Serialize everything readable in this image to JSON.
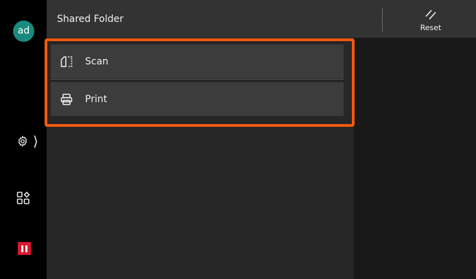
{
  "rail": {
    "avatar_text": "ad",
    "settings_icon": "gear-icon",
    "apps_icon": "apps-icon",
    "stop_icon": "pause-icon",
    "stop_color": "#d8182f"
  },
  "header": {
    "title": "Shared Folder",
    "reset_label": "Reset",
    "reset_icon": "reset-slash-icon"
  },
  "menu": {
    "highlight_color": "#f35a0f",
    "items": [
      {
        "label": "Scan",
        "icon": "scan-icon"
      },
      {
        "label": "Print",
        "icon": "printer-icon"
      }
    ]
  }
}
